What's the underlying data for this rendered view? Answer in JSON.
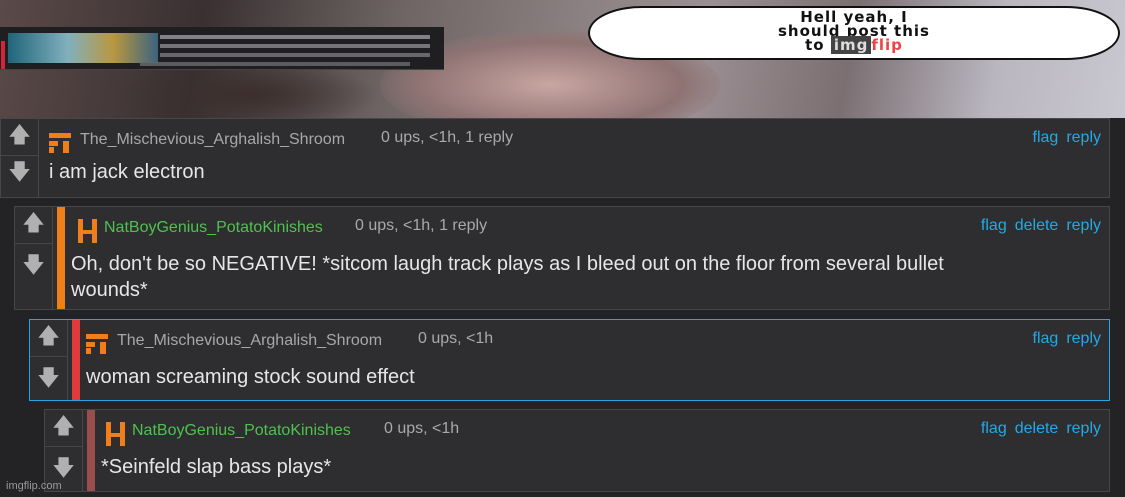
{
  "meme": {
    "bubble_line1": "Hell yeah, I",
    "bubble_line2": "should post this",
    "bubble_line3_prefix": "to",
    "bubble_img": "img",
    "bubble_flip": "flip"
  },
  "comments": [
    {
      "username": "The_Mischevious_Arghalish_Shroom",
      "meta": "0 ups, <1h, 1 reply",
      "actions": [
        "flag",
        "reply"
      ],
      "text": "i am jack electron",
      "username_color": "#a8a8a8",
      "accent_color": "none"
    },
    {
      "username": "NatBoyGenius_PotatoKinishes",
      "meta": "0 ups, <1h, 1 reply",
      "actions": [
        "flag",
        "delete",
        "reply"
      ],
      "text": "Oh, don't be so NEGATIVE! *sitcom laugh track plays as I bleed out on the floor from several bullet",
      "text2": "wounds*",
      "username_color": "#4fc14f",
      "accent_color": "#f07e1b"
    },
    {
      "username": "The_Mischevious_Arghalish_Shroom",
      "meta": "0 ups, <1h",
      "actions": [
        "flag",
        "reply"
      ],
      "text": "woman screaming stock sound effect",
      "username_color": "#a8a8a8",
      "accent_color": "#e03a3a"
    },
    {
      "username": "NatBoyGenius_PotatoKinishes",
      "meta": "0 ups, <1h",
      "actions": [
        "flag",
        "delete",
        "reply"
      ],
      "text": "*Seinfeld slap bass plays*",
      "username_color": "#4fc14f",
      "accent_color": "#9a4d4d"
    }
  ],
  "vote_icons": {
    "up": "arrow-up-icon",
    "down": "arrow-down-icon"
  },
  "watermark": "imgflip.com",
  "colors": {
    "link": "#23a9e8",
    "background": "#232325",
    "panel": "#2e2e30"
  }
}
